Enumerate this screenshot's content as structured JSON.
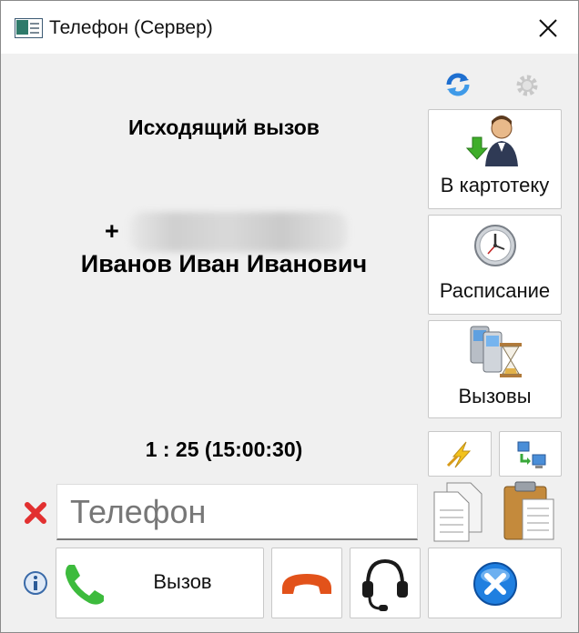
{
  "window": {
    "title": "Телефон (Сервер)"
  },
  "call": {
    "direction": "Исходящий вызов",
    "number_prefix": "+",
    "caller_name": "Иванов Иван Иванович",
    "duration": "1 : 25 (15:00:30)"
  },
  "side_buttons": {
    "to_card": "В картотеку",
    "schedule": "Расписание",
    "calls": "Вызовы"
  },
  "phone_field": {
    "placeholder": "Телефон"
  },
  "bottom": {
    "call_label": "Вызов"
  },
  "colors": {
    "titlebar": "#ffffff",
    "background": "#f0f0f0",
    "accept_green": "#3dbb3d",
    "decline_orange": "#e2521a",
    "close_blue": "#1f7fe0",
    "clear_red": "#e23030"
  }
}
